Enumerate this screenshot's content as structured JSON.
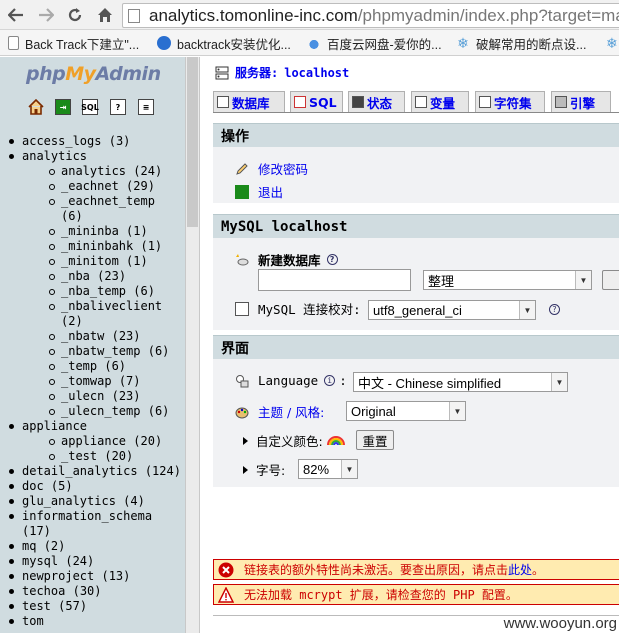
{
  "browser": {
    "url_host": "analytics.tomonline-inc.com",
    "url_path": "/phpmyadmin/index.php?target=ma",
    "nav": [
      "back-icon",
      "forward-icon",
      "reload-icon",
      "home-icon"
    ],
    "bookmarks": [
      {
        "label": "Back Track下建立\"...",
        "icon": "page-icon"
      },
      {
        "label": "backtrack安装优化...",
        "icon": "backtrack-icon"
      },
      {
        "label": "百度云网盘-爱你的...",
        "icon": "cloud-icon"
      },
      {
        "label": "破解常用的断点设...",
        "icon": "snowflake-icon"
      }
    ]
  },
  "sidebar": {
    "logo_php": "php",
    "logo_my": "My",
    "logo_admin": "Admin",
    "icons": [
      "home-icon",
      "exit-icon",
      "sql-icon",
      "help-icon",
      "docs-icon"
    ],
    "tree": [
      {
        "name": "access_logs",
        "count": "(3)"
      },
      {
        "name": "analytics",
        "count": ""
      },
      {
        "sub": "analytics",
        "count": "(24)"
      },
      {
        "sub": "_eachnet",
        "count": "(29)"
      },
      {
        "sub": "_eachnet_temp",
        "count": "(6)"
      },
      {
        "sub": "_mininba",
        "count": "(1)"
      },
      {
        "sub": "_mininbahk",
        "count": "(1)"
      },
      {
        "sub": "_minitom",
        "count": "(1)"
      },
      {
        "sub": "_nba",
        "count": "(23)"
      },
      {
        "sub": "_nba_temp",
        "count": "(6)"
      },
      {
        "sub": "_nbaliveclient",
        "count": "(2)"
      },
      {
        "sub": "_nbatw",
        "count": "(23)"
      },
      {
        "sub": "_nbatw_temp",
        "count": "(6)"
      },
      {
        "sub": "_temp",
        "count": "(6)"
      },
      {
        "sub": "_tomwap",
        "count": "(7)"
      },
      {
        "sub": "_ulecn",
        "count": "(23)"
      },
      {
        "sub": "_ulecn_temp",
        "count": "(6)"
      },
      {
        "name": "appliance",
        "count": ""
      },
      {
        "sub": "appliance",
        "count": "(20)"
      },
      {
        "sub": "_test",
        "count": "(20)"
      },
      {
        "name": "detail_analytics",
        "count": "(124)"
      },
      {
        "name": "doc",
        "count": "(5)"
      },
      {
        "name": "glu_analytics",
        "count": "(4)"
      },
      {
        "name": "information_schema",
        "count": "(17)"
      },
      {
        "name": "mq",
        "count": "(2)"
      },
      {
        "name": "mysql",
        "count": "(24)"
      },
      {
        "name": "newproject",
        "count": "(13)"
      },
      {
        "name": "techoa",
        "count": "(30)"
      },
      {
        "name": "test",
        "count": "(57)"
      },
      {
        "name": "tom",
        "count": ""
      }
    ]
  },
  "main": {
    "server_label": "服务器:",
    "server_name": "localhost",
    "tabs": [
      {
        "label": "数据库",
        "icon": "database-icon"
      },
      {
        "label": "SQL",
        "icon": "sql-icon"
      },
      {
        "label": "状态",
        "icon": "status-icon"
      },
      {
        "label": "变量",
        "icon": "variables-icon"
      },
      {
        "label": "字符集",
        "icon": "charset-icon"
      },
      {
        "label": "引擎",
        "icon": "engine-icon"
      }
    ],
    "operations": {
      "title": "操作",
      "change_password": "修改密码",
      "logout": "退出"
    },
    "mysql": {
      "title": "MySQL localhost",
      "create_db_label": "新建数据库",
      "create_db_value": "",
      "collation_select": "整理",
      "connection_collation_label": "MySQL 连接校对:",
      "connection_collation_value": "utf8_general_ci"
    },
    "interface": {
      "title": "界面",
      "language_label": "Language",
      "language_value": "中文 - Chinese simplified",
      "theme_label": "主题 / 风格:",
      "theme_value": "Original",
      "custom_color_label": "自定义颜色:",
      "reset_button": "重置",
      "font_size_label": "字号:",
      "font_size_value": "82%"
    },
    "notices": {
      "error_text": "链接表的额外特性尚未激活。要查出原因，请点击",
      "error_link": "此处",
      "error_end": "。",
      "warning_text": "无法加载 mcrypt 扩展，请检查您的 PHP 配置。"
    }
  },
  "watermark": "www.wooyun.org",
  "colors": {
    "sidebar_bg": "#d0dce0",
    "link": "#0000ee",
    "error": "#cc0000",
    "notice_bg": "#ffebb0"
  }
}
